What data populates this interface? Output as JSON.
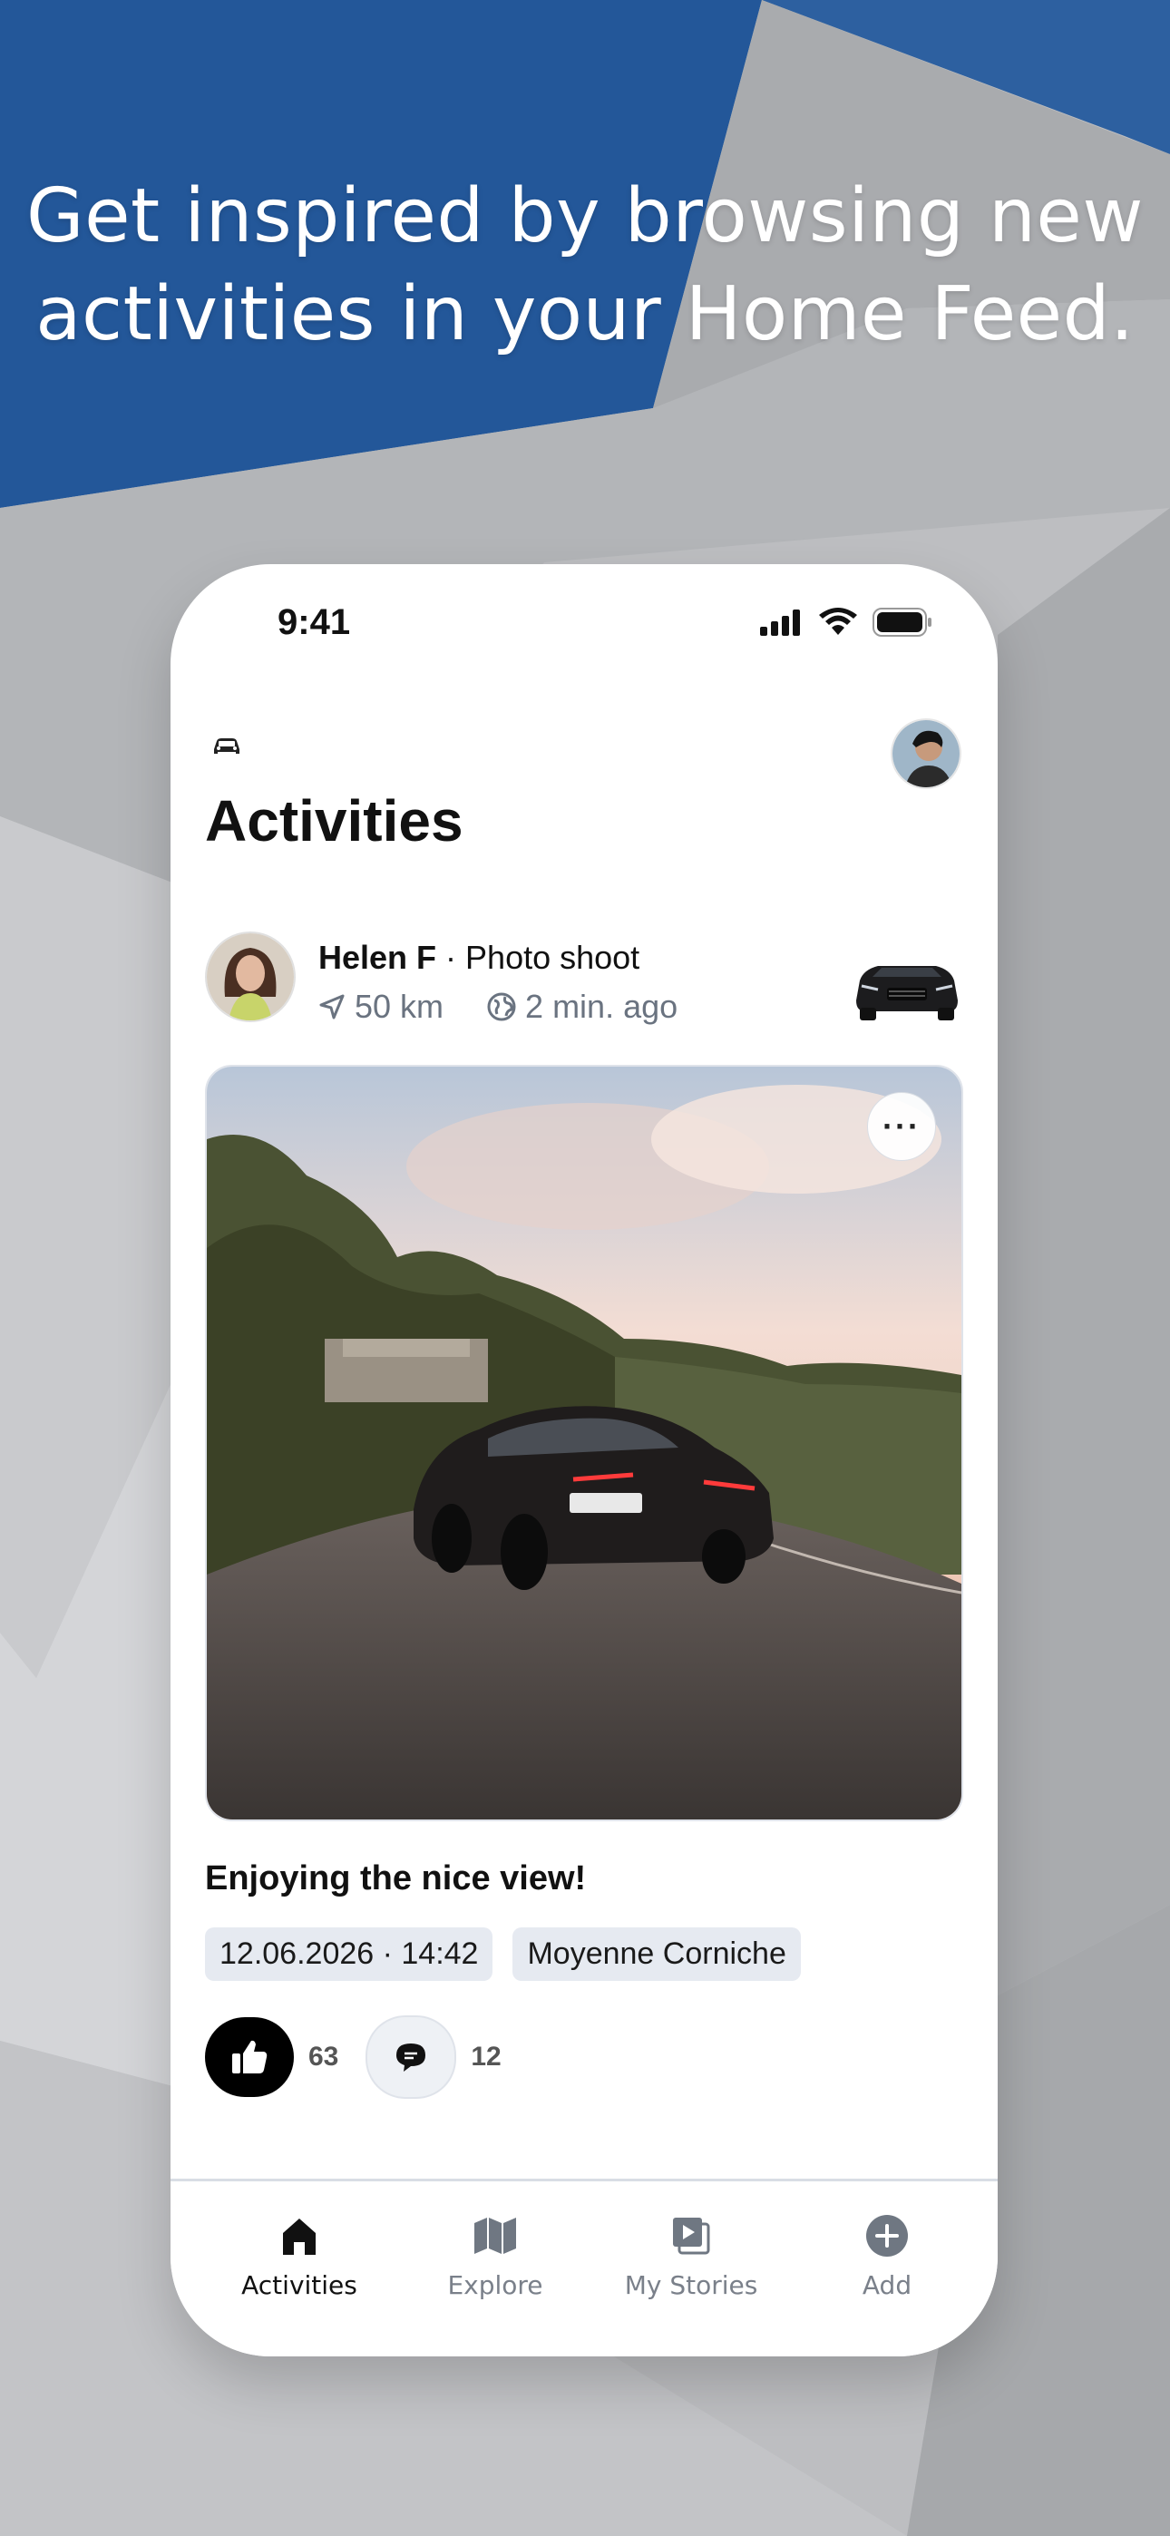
{
  "headline": {
    "line1": "Get inspired by browsing new",
    "line2": "activities in your Home Feed."
  },
  "status_bar": {
    "time": "9:41"
  },
  "page_title": "Activities",
  "post": {
    "author": "Helen F",
    "category": "· Photo shoot",
    "distance": "50 km",
    "time_ago": "2 min. ago",
    "caption": "Enjoying the nice view!",
    "date_tag": "12.06.2026 · 14:42",
    "location_tag": "Moyenne Corniche",
    "likes": "63",
    "comments": "12",
    "more_label": "···"
  },
  "tabs": [
    {
      "label": "Activities",
      "icon": "home-icon",
      "active": true
    },
    {
      "label": "Explore",
      "icon": "map-icon",
      "active": false
    },
    {
      "label": "My Stories",
      "icon": "stories-icon",
      "active": false
    },
    {
      "label": "Add",
      "icon": "plus-circle-icon",
      "active": false
    }
  ],
  "colors": {
    "brand_blue": "#235799",
    "tag_bg": "#e6eaf1",
    "inactive_gray": "#7a808a"
  }
}
